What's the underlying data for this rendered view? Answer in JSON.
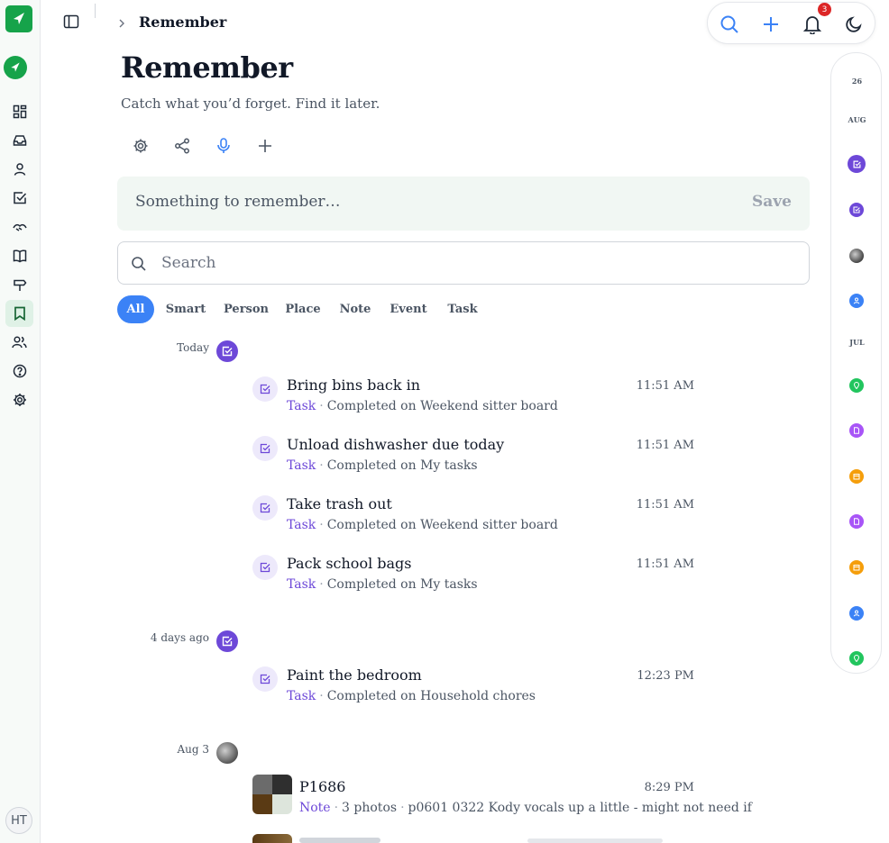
{
  "header": {
    "breadcrumb": "Remember",
    "notification_count": "3"
  },
  "page": {
    "title": "Remember",
    "subtitle": "Catch what you’d forget. Find it later."
  },
  "composer": {
    "placeholder": "Something to remember…",
    "save_label": "Save"
  },
  "search": {
    "placeholder": "Search"
  },
  "filters": [
    "All",
    "Smart",
    "Person",
    "Place",
    "Note",
    "Event",
    "Task"
  ],
  "groups": [
    {
      "label": "Today",
      "items": [
        {
          "title": "Bring bins back in",
          "type": "Task",
          "meta": "Completed on Weekend sitter board",
          "time": "11:51 AM"
        },
        {
          "title": "Unload dishwasher due today",
          "type": "Task",
          "meta": "Completed on My tasks",
          "time": "11:51 AM"
        },
        {
          "title": "Take trash out",
          "type": "Task",
          "meta": "Completed on Weekend sitter board",
          "time": "11:51 AM"
        },
        {
          "title": "Pack school bags",
          "type": "Task",
          "meta": "Completed on My tasks",
          "time": "11:51 AM"
        }
      ]
    },
    {
      "label": "4 days ago",
      "items": [
        {
          "title": "Paint the bedroom",
          "type": "Task",
          "meta": "Completed on Household chores",
          "time": "12:23 PM"
        }
      ]
    },
    {
      "label": "Aug 3",
      "items": [
        {
          "title": "P1686",
          "type": "Note",
          "photos": "3 photos",
          "meta": "p0601 0322 Kody vocals up a little - might not need if",
          "time": "8:29 PM"
        }
      ]
    }
  ],
  "strip": {
    "day": "26",
    "month1": "AUG",
    "month2": "JUL"
  },
  "user": {
    "initials": "HT"
  },
  "colors": {
    "brand": "#16a34a",
    "accent": "#3b82f6",
    "task": "#6d48d8"
  }
}
